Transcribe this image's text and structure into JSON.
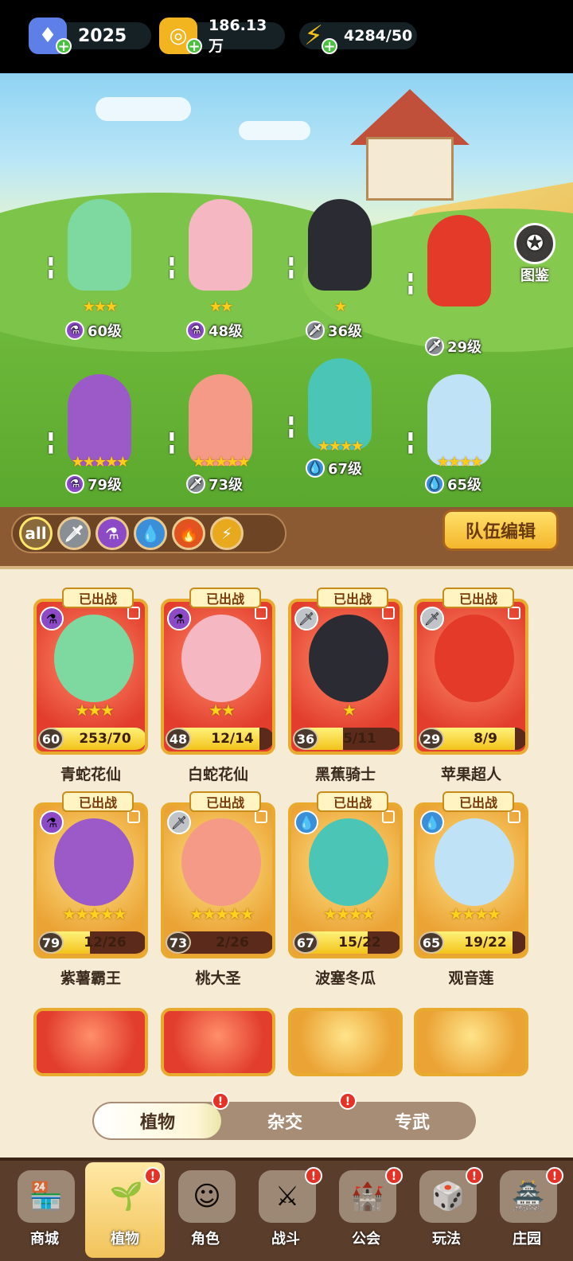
{
  "resources": {
    "diamonds": "2025",
    "gold": "186.13万",
    "energy": "4284/50"
  },
  "atlas_label": "图鉴",
  "team_heroes": [
    {
      "name": "青蛇花仙",
      "level": "60级",
      "stars": "★★★",
      "element": "purple-potion-icon",
      "color": "#7ed9a0"
    },
    {
      "name": "白蛇花仙",
      "level": "48级",
      "stars": "★★",
      "element": "purple-potion-icon",
      "color": "#f5b8c2"
    },
    {
      "name": "黑蕉骑士",
      "level": "36级",
      "stars": "★",
      "element": "sword-icon",
      "color": "#2b2b33"
    },
    {
      "name": "苹果超人",
      "level": "29级",
      "stars": "",
      "element": "sword-icon",
      "color": "#e33a2a"
    },
    {
      "name": "紫薯霸王",
      "level": "79级",
      "stars": "★★★★★",
      "element": "purple-potion-icon",
      "color": "#9c5ac8"
    },
    {
      "name": "桃大圣",
      "level": "73级",
      "stars": "★★★★★",
      "element": "sword-icon",
      "color": "#f49a86"
    },
    {
      "name": "波塞冬瓜",
      "level": "67级",
      "stars": "★★★★",
      "element": "water-drop-icon",
      "color": "#4bc6b6"
    },
    {
      "name": "观音莲",
      "level": "65级",
      "stars": "★★★★",
      "element": "water-drop-icon",
      "color": "#bfe2f7"
    }
  ],
  "filters": [
    "all",
    "sword-icon",
    "potion-icon",
    "water-icon",
    "fire-icon",
    "lightning-icon"
  ],
  "filter_all_label": "all",
  "team_edit_label": "队伍编辑",
  "deployed_label": "已出战",
  "cards": [
    {
      "name": "青蛇花仙",
      "level": "60",
      "progress": "253/70",
      "fill": 1.0,
      "stars": "★★★",
      "bg": "red",
      "color": "#7ed9a0",
      "element": "potion"
    },
    {
      "name": "白蛇花仙",
      "level": "48",
      "progress": "12/14",
      "fill": 0.86,
      "stars": "★★",
      "bg": "red",
      "color": "#f5b8c2",
      "element": "potion"
    },
    {
      "name": "黑蕉骑士",
      "level": "36",
      "progress": "5/11",
      "fill": 0.45,
      "stars": "★",
      "bg": "red",
      "color": "#2b2b33",
      "element": "sword"
    },
    {
      "name": "苹果超人",
      "level": "29",
      "progress": "8/9",
      "fill": 0.89,
      "stars": "",
      "bg": "red",
      "color": "#e33a2a",
      "element": "sword"
    },
    {
      "name": "紫薯霸王",
      "level": "79",
      "progress": "12/26",
      "fill": 0.46,
      "stars": "★★★★★",
      "bg": "gold",
      "color": "#9c5ac8",
      "element": "potion"
    },
    {
      "name": "桃大圣",
      "level": "73",
      "progress": "2/26",
      "fill": 0.08,
      "stars": "★★★★★",
      "bg": "gold",
      "color": "#f49a86",
      "element": "sword"
    },
    {
      "name": "波塞冬瓜",
      "level": "67",
      "progress": "15/22",
      "fill": 0.68,
      "stars": "★★★★",
      "bg": "gold",
      "color": "#4bc6b6",
      "element": "water"
    },
    {
      "name": "观音莲",
      "level": "65",
      "progress": "19/22",
      "fill": 0.86,
      "stars": "★★★★",
      "bg": "gold",
      "color": "#bfe2f7",
      "element": "water"
    }
  ],
  "tabs": [
    {
      "label": "植物",
      "active": true,
      "badge": "!"
    },
    {
      "label": "杂交",
      "active": false,
      "badge": "!"
    },
    {
      "label": "专武",
      "active": false,
      "badge": ""
    }
  ],
  "nav": [
    {
      "label": "商城",
      "icon": "shop-icon",
      "badge": ""
    },
    {
      "label": "植物",
      "icon": "plant-icon",
      "badge": "!"
    },
    {
      "label": "角色",
      "icon": "character-icon",
      "badge": ""
    },
    {
      "label": "战斗",
      "icon": "battle-icon",
      "badge": "!"
    },
    {
      "label": "公会",
      "icon": "guild-icon",
      "badge": "!"
    },
    {
      "label": "玩法",
      "icon": "gameplay-icon",
      "badge": "!"
    },
    {
      "label": "庄园",
      "icon": "manor-icon",
      "badge": "!"
    }
  ]
}
